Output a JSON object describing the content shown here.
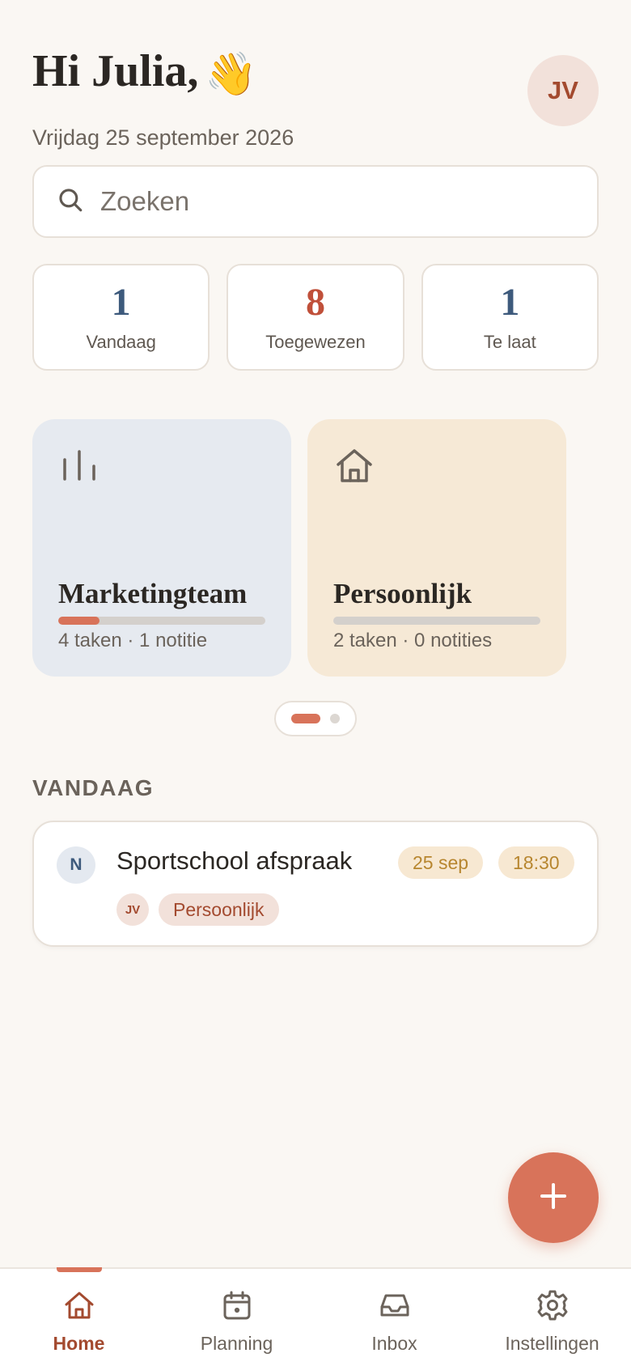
{
  "header": {
    "greeting": "Hi Julia,",
    "wave_emoji": "👋",
    "date": "Vrijdag 25 september 2026",
    "avatar_initials": "JV"
  },
  "search": {
    "placeholder": "Zoeken",
    "icon": "search-icon"
  },
  "stats": [
    {
      "value": "1",
      "label": "Vandaag",
      "color": "#3d5a7c"
    },
    {
      "value": "8",
      "label": "Toegewezen",
      "color": "#c0503a"
    },
    {
      "value": "1",
      "label": "Te laat",
      "color": "#3d5a7c"
    }
  ],
  "projects": [
    {
      "name": "Marketingteam",
      "meta": "4 taken · 1 notitie",
      "icon": "bar-chart-icon",
      "background": "#e6eaf0",
      "progress": 0.2
    },
    {
      "name": "Persoonlijk",
      "meta": "2 taken · 0 notities",
      "icon": "home-icon",
      "background": "#f6e9d6",
      "progress": 0
    }
  ],
  "carousel": {
    "page": 1,
    "pages": 2
  },
  "today": {
    "section_title": "VANDAAG",
    "task": {
      "priority": "N",
      "title": "Sportschool afspraak",
      "date": "25 sep",
      "time": "18:30",
      "assignee_initials": "JV",
      "tag": "Persoonlijk"
    }
  },
  "fab": {
    "icon": "plus-icon"
  },
  "nav": [
    {
      "label": "Home",
      "icon": "home-icon",
      "active": true
    },
    {
      "label": "Planning",
      "icon": "calendar-icon",
      "active": false
    },
    {
      "label": "Inbox",
      "icon": "inbox-icon",
      "active": false
    },
    {
      "label": "Instellingen",
      "icon": "gear-icon",
      "active": false
    }
  ],
  "colors": {
    "accent": "#d8735a",
    "accent_dark": "#a34a2f",
    "background": "#faf7f3"
  }
}
